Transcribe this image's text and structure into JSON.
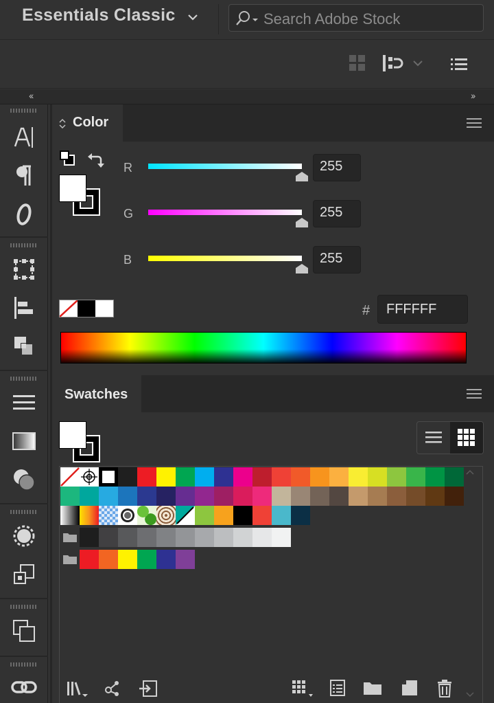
{
  "workspace": {
    "title": "Essentials Classic"
  },
  "search": {
    "placeholder": "Search Adobe Stock"
  },
  "color_panel": {
    "tab_label": "Color",
    "channels": [
      {
        "label": "R",
        "value": "255",
        "gradient": [
          "#00e5ff",
          "#ffffff"
        ]
      },
      {
        "label": "G",
        "value": "255",
        "gradient": [
          "#ff00ff",
          "#ffffff"
        ]
      },
      {
        "label": "B",
        "value": "255",
        "gradient": [
          "#ffff00",
          "#ffffff"
        ]
      }
    ],
    "hash_label": "#",
    "hex_value": "FFFFFF",
    "fill_color": "#ffffff"
  },
  "swatches_panel": {
    "tab_label": "Swatches",
    "rows": [
      [
        "none",
        "registration",
        "#ffffff",
        "#1f1f1f",
        "#ed1c24",
        "#fff200",
        "#00a651",
        "#00aeef",
        "#2e3192",
        "#ec008c",
        "#be1e2d",
        "#ef4136",
        "#f15a29",
        "#f7941d",
        "#fbb040",
        "#f9ed32",
        "#d7df23",
        "#8dc63f",
        "#39b54a",
        "#009444",
        "#006838"
      ],
      [
        "#1cb77e",
        "#00a79d",
        "#27aae1",
        "#1c75bc",
        "#2b3990",
        "#262262",
        "#662d91",
        "#92278f",
        "#9e1f63",
        "#da1c5c",
        "#ee2a7b",
        "#c2b59b",
        "#998675",
        "#736357",
        "#534741",
        "#c49a6c",
        "#a67c52",
        "#8b5e3c",
        "#754c29",
        "#603913",
        "#42210b"
      ],
      [
        "grad-bw",
        "grad-orange",
        "grad-blue",
        "pattern-dots",
        "pattern-leaves",
        "pattern-swirl",
        "split-teal",
        "#8dc63f",
        "#f7a21d",
        "#000000",
        "#ef4136",
        "#4ab8cb",
        "#0b2f45"
      ]
    ],
    "gray_group": [
      "#1e1e1e",
      "#414042",
      "#58595b",
      "#6d6e71",
      "#808285",
      "#939598",
      "#a7a9ac",
      "#bcbec0",
      "#d1d3d4",
      "#e6e7e8",
      "#f1f2f2"
    ],
    "bright_group": [
      "#ed1c24",
      "#f26522",
      "#fff200",
      "#00a651",
      "#2e3192",
      "#7f3f98"
    ]
  }
}
